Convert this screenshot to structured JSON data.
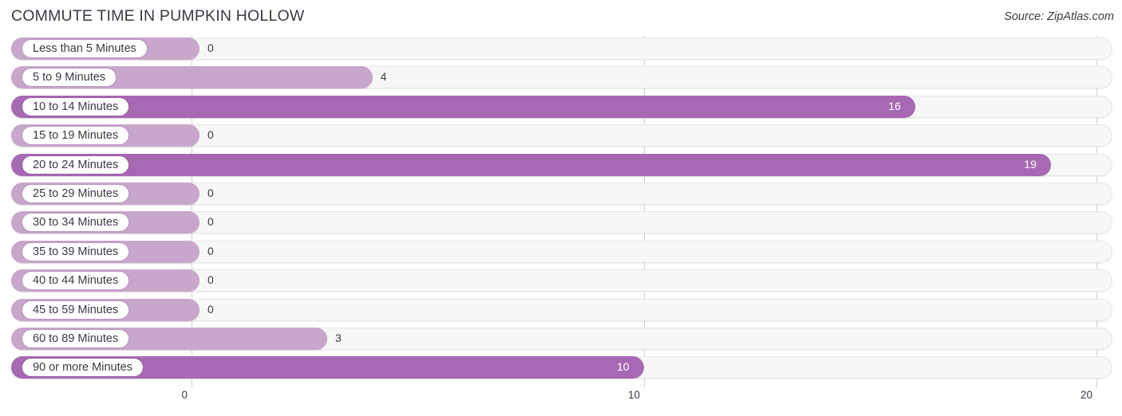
{
  "header": {
    "title": "COMMUTE TIME IN PUMPKIN HOLLOW",
    "source": "Source: ZipAtlas.com"
  },
  "colors": {
    "bar_light": "#c9a6cc",
    "bar_dark": "#a869b4",
    "track": "#f7f7f7",
    "gridline": "#cfcfcf",
    "text": "#3a3a46"
  },
  "chart_data": {
    "type": "bar",
    "orientation": "horizontal",
    "title": "COMMUTE TIME IN PUMPKIN HOLLOW",
    "xlabel": "",
    "ylabel": "",
    "xlim": [
      0,
      20
    ],
    "xticks": [
      0,
      10,
      20
    ],
    "xtick_labels": [
      "0",
      "10",
      "20"
    ],
    "grid": true,
    "legend": false,
    "categories": [
      "Less than 5 Minutes",
      "5 to 9 Minutes",
      "10 to 14 Minutes",
      "15 to 19 Minutes",
      "20 to 24 Minutes",
      "25 to 29 Minutes",
      "30 to 34 Minutes",
      "35 to 39 Minutes",
      "40 to 44 Minutes",
      "45 to 59 Minutes",
      "60 to 89 Minutes",
      "90 or more Minutes"
    ],
    "values": [
      0,
      4,
      16,
      0,
      19,
      0,
      0,
      0,
      0,
      0,
      3,
      10
    ],
    "value_labels": [
      "0",
      "4",
      "16",
      "0",
      "19",
      "0",
      "0",
      "0",
      "0",
      "0",
      "3",
      "10"
    ]
  }
}
